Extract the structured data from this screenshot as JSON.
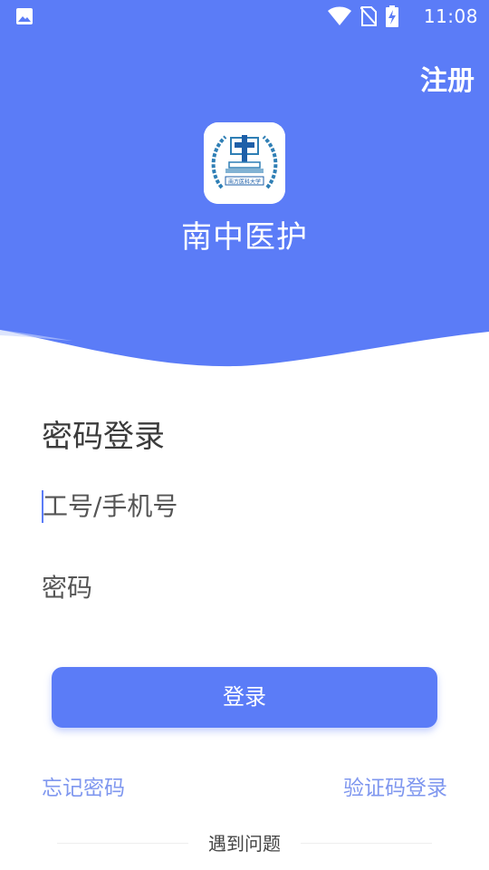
{
  "status_bar": {
    "time": "11:08",
    "icons": [
      "gallery-icon",
      "wifi-icon",
      "no-sim-icon",
      "battery-charging-icon"
    ]
  },
  "header": {
    "register_label": "注册",
    "app_name": "南中医护",
    "logo_text": "南方医科大学",
    "background_color": "#5b7cf7"
  },
  "login": {
    "title": "密码登录",
    "account_placeholder": "工号/手机号",
    "password_placeholder": "密码",
    "submit_label": "登录",
    "forgot_password_label": "忘记密码",
    "sms_login_label": "验证码登录",
    "help_label": "遇到问题"
  },
  "colors": {
    "accent": "#5b7cf7",
    "link": "#7f97ef"
  }
}
